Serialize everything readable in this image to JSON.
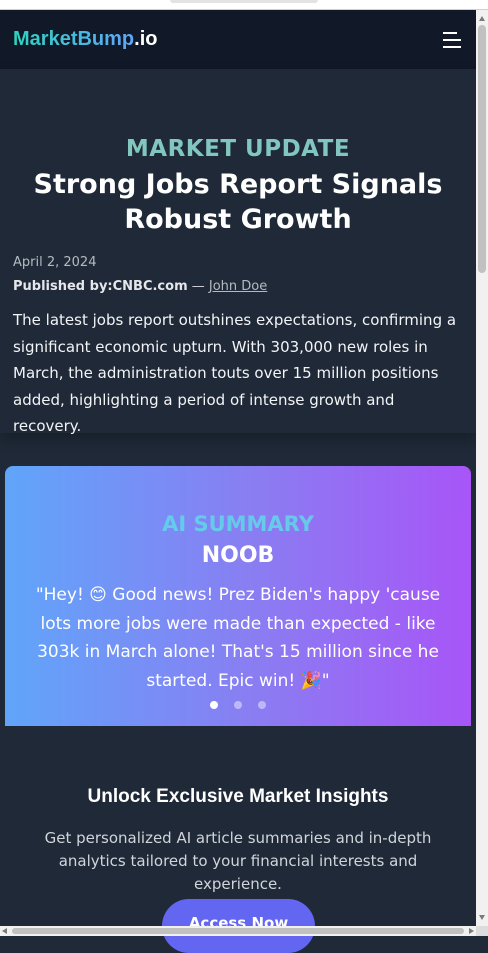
{
  "header": {
    "brand_name": "MarketBump",
    "brand_tld": ".io",
    "menu_icon": "hamburger-menu-icon"
  },
  "article": {
    "kicker": "MARKET UPDATE",
    "title": "Strong Jobs Report Signals Robust Growth",
    "date": "April 2, 2024",
    "published_label": "Published by:",
    "source": "CNBC.com",
    "separator": " — ",
    "author": "John Doe",
    "body": "The latest jobs report outshines expectations, confirming a significant economic upturn. With 303,000 new roles in March, the administration touts over 15 million positions added, highlighting a period of intense growth and recovery."
  },
  "ai_summary": {
    "label": "AI SUMMARY",
    "level": "NOOB",
    "quote": "\"Hey! 😊 Good news! Prez Biden's happy 'cause lots more jobs were made than expected - like 303k in March alone! That's 15 million since he started. Epic win! 🎉\"",
    "slides_total": 3,
    "active_slide": 1
  },
  "cta": {
    "title": "Unlock Exclusive Market Insights",
    "text": "Get personalized AI article summaries and in-depth analytics tailored to your financial interests and experience.",
    "button_label": "Access Now"
  },
  "colors": {
    "header_bg": "#111827",
    "page_bg": "#1f2937",
    "accent_teal": "#81c7bf",
    "gradient_start": "#60a5fa",
    "gradient_end": "#a855f7",
    "button": "#6366f1"
  }
}
